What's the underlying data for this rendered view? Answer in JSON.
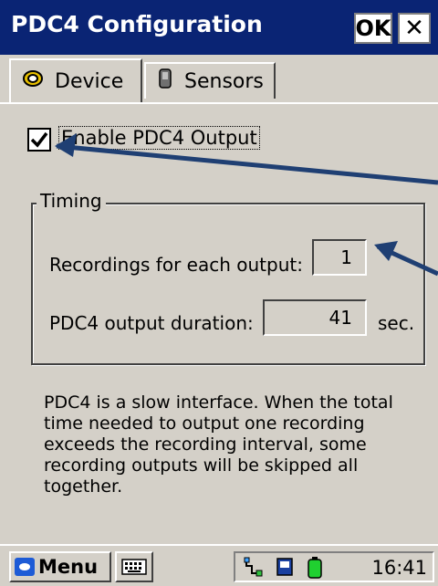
{
  "window": {
    "title": "PDC4 Configuration",
    "ok_label": "OK",
    "close_label": "✕"
  },
  "tabs": [
    {
      "label": "Device",
      "icon": "device-icon",
      "selected": true
    },
    {
      "label": "Sensors",
      "icon": "sensor-icon",
      "selected": false
    }
  ],
  "enable_output": {
    "label": "Enable PDC4 Output",
    "checked": true
  },
  "timing": {
    "title": "Timing",
    "recordings_label": "Recordings for each output:",
    "recordings_value": "1",
    "duration_label": "PDC4 output duration:",
    "duration_value": "41",
    "duration_unit": "sec."
  },
  "description": "PDC4 is a slow interface. When the total time needed to output one recording exceeds the recording interval, some recording outputs will be skipped all together.",
  "taskbar": {
    "start_label": "Menu",
    "clock": "16:41",
    "tray_icons": [
      "network-icon",
      "storage-icon",
      "battery-icon"
    ]
  },
  "colors": {
    "titlebar": "#0a2474",
    "background": "#d4d0c8",
    "arrow": "#1f3f73"
  }
}
